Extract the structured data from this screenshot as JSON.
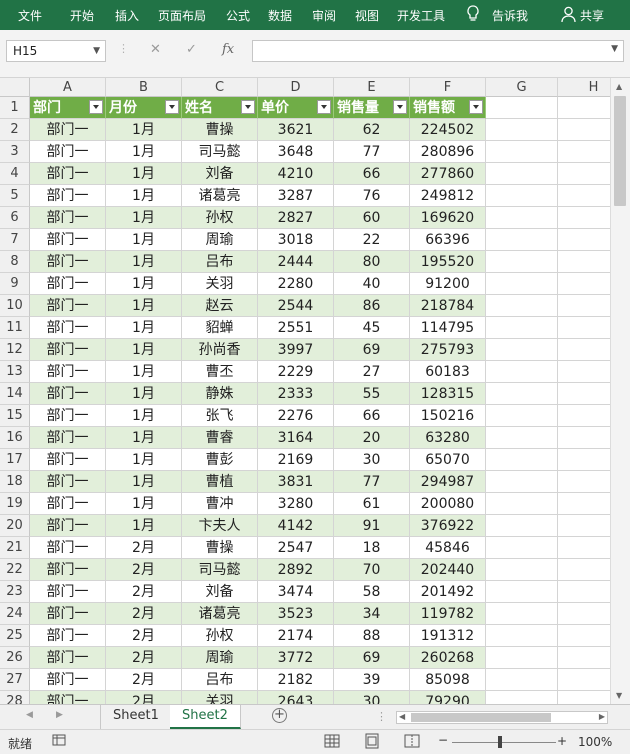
{
  "ribbon": {
    "tabs": [
      "文件",
      "开始",
      "插入",
      "页面布局",
      "公式",
      "数据",
      "审阅",
      "视图",
      "开发工具"
    ],
    "tell_me": "告诉我",
    "share": "共享"
  },
  "formula_bar": {
    "name_box": "H15",
    "fx": "fx",
    "value": ""
  },
  "columns": [
    "A",
    "B",
    "C",
    "D",
    "E",
    "F",
    "G",
    "H"
  ],
  "table_headers": [
    "部门",
    "月份",
    "姓名",
    "单价",
    "销售量",
    "销售额"
  ],
  "rows": [
    [
      "部门一",
      "1月",
      "曹操",
      "3621",
      "62",
      "224502"
    ],
    [
      "部门一",
      "1月",
      "司马懿",
      "3648",
      "77",
      "280896"
    ],
    [
      "部门一",
      "1月",
      "刘备",
      "4210",
      "66",
      "277860"
    ],
    [
      "部门一",
      "1月",
      "诸葛亮",
      "3287",
      "76",
      "249812"
    ],
    [
      "部门一",
      "1月",
      "孙权",
      "2827",
      "60",
      "169620"
    ],
    [
      "部门一",
      "1月",
      "周瑜",
      "3018",
      "22",
      "66396"
    ],
    [
      "部门一",
      "1月",
      "吕布",
      "2444",
      "80",
      "195520"
    ],
    [
      "部门一",
      "1月",
      "关羽",
      "2280",
      "40",
      "91200"
    ],
    [
      "部门一",
      "1月",
      "赵云",
      "2544",
      "86",
      "218784"
    ],
    [
      "部门一",
      "1月",
      "貂蝉",
      "2551",
      "45",
      "114795"
    ],
    [
      "部门一",
      "1月",
      "孙尚香",
      "3997",
      "69",
      "275793"
    ],
    [
      "部门一",
      "1月",
      "曹丕",
      "2229",
      "27",
      "60183"
    ],
    [
      "部门一",
      "1月",
      "静姝",
      "2333",
      "55",
      "128315"
    ],
    [
      "部门一",
      "1月",
      "张飞",
      "2276",
      "66",
      "150216"
    ],
    [
      "部门一",
      "1月",
      "曹睿",
      "3164",
      "20",
      "63280"
    ],
    [
      "部门一",
      "1月",
      "曹彭",
      "2169",
      "30",
      "65070"
    ],
    [
      "部门一",
      "1月",
      "曹植",
      "3831",
      "77",
      "294987"
    ],
    [
      "部门一",
      "1月",
      "曹冲",
      "3280",
      "61",
      "200080"
    ],
    [
      "部门一",
      "1月",
      "卞夫人",
      "4142",
      "91",
      "376922"
    ],
    [
      "部门一",
      "2月",
      "曹操",
      "2547",
      "18",
      "45846"
    ],
    [
      "部门一",
      "2月",
      "司马懿",
      "2892",
      "70",
      "202440"
    ],
    [
      "部门一",
      "2月",
      "刘备",
      "3474",
      "58",
      "201492"
    ],
    [
      "部门一",
      "2月",
      "诸葛亮",
      "3523",
      "34",
      "119782"
    ],
    [
      "部门一",
      "2月",
      "孙权",
      "2174",
      "88",
      "191312"
    ],
    [
      "部门一",
      "2月",
      "周瑜",
      "3772",
      "69",
      "260268"
    ],
    [
      "部门一",
      "2月",
      "吕布",
      "2182",
      "39",
      "85098"
    ],
    [
      "部门一",
      "2月",
      "关羽",
      "2643",
      "30",
      "79290"
    ]
  ],
  "sheets": [
    "Sheet1",
    "Sheet2"
  ],
  "active_sheet": "Sheet2",
  "status": {
    "ready": "就绪",
    "zoom": "100%",
    "minus": "−",
    "plus": "+"
  },
  "colors": {
    "ribbon": "#217346",
    "header_fill": "#70ad47",
    "band_fill": "#e2efda"
  }
}
